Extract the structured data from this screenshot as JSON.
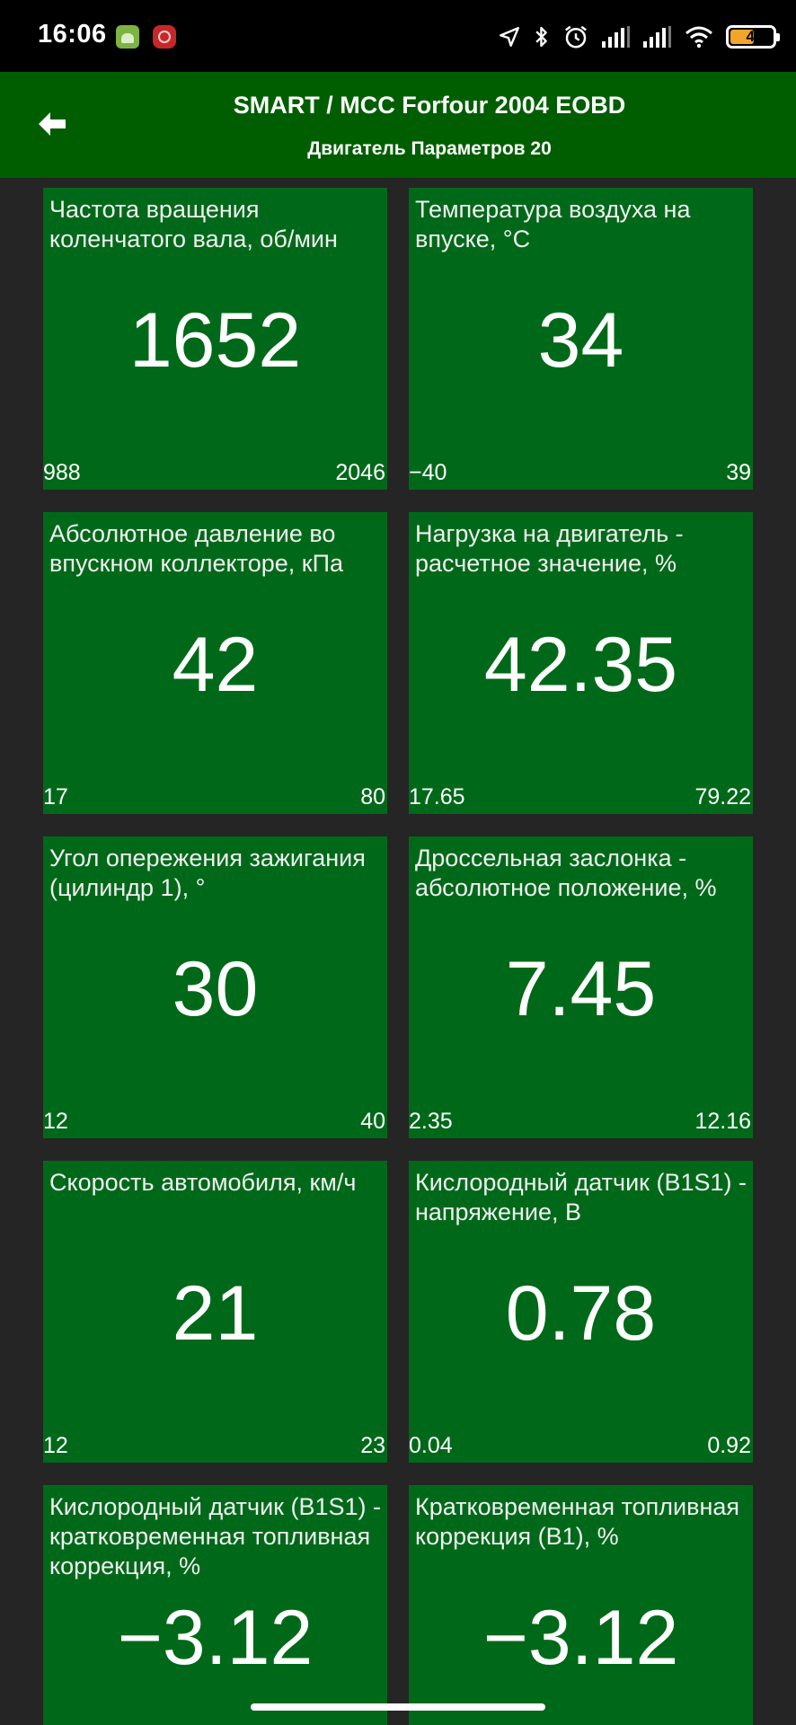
{
  "status_bar": {
    "time": "16:06",
    "battery_level": "49",
    "icons": [
      "android-notification-icon",
      "app-notification-icon",
      "location-icon",
      "bluetooth-icon",
      "alarm-icon",
      "signal-icon",
      "signal-icon",
      "wifi-icon",
      "battery-icon"
    ]
  },
  "header": {
    "title": "SMART / MCC Forfour 2004 EOBD",
    "subtitle": "Двигатель Параметров 20",
    "back_icon": "back-arrow-icon"
  },
  "colors": {
    "header_bg": "#005e00",
    "tile_bg": "#006919",
    "grid_bg": "#252525",
    "battery_fill": "#f2a52a"
  },
  "gauges": [
    {
      "label": "Частота вращения коленчатого вала, об/мин",
      "value": "1652",
      "min": "988",
      "max": "2046"
    },
    {
      "label": "Температура воздуха на впуске, °C",
      "value": "34",
      "min": "−40",
      "max": "39"
    },
    {
      "label": "Абсолютное давление во впускном коллекторе, кПа",
      "value": "42",
      "min": "17",
      "max": "80"
    },
    {
      "label": "Нагрузка на двигатель - расчетное значение, %",
      "value": "42.35",
      "min": "17.65",
      "max": "79.22"
    },
    {
      "label": "Угол опережения зажигания (цилиндр 1), °",
      "value": "30",
      "min": "12",
      "max": "40"
    },
    {
      "label": "Дроссельная заслонка - абсолютное положение, %",
      "value": "7.45",
      "min": "2.35",
      "max": "12.16"
    },
    {
      "label": "Скорость автомобиля, км/ч",
      "value": "21",
      "min": "12",
      "max": "23"
    },
    {
      "label": "Кислородный датчик (B1S1) - напряжение, В",
      "value": "0.78",
      "min": "0.04",
      "max": "0.92"
    },
    {
      "label": "Кислородный датчик (B1S1) - кратковременная топливная коррекция, %",
      "value": "−3.12",
      "min": "",
      "max": ""
    },
    {
      "label": "Кратковременная топливная коррекция (B1), %",
      "value": "−3.12",
      "min": "",
      "max": ""
    }
  ]
}
